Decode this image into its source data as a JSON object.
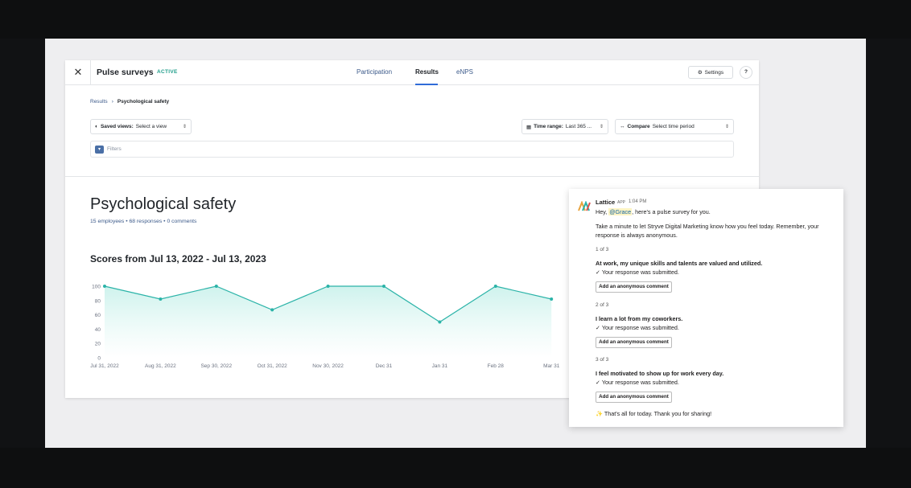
{
  "app": {
    "title": "Pulse surveys",
    "status_badge": "ACTIVE",
    "tabs": [
      {
        "label": "Participation"
      },
      {
        "label": "Results"
      },
      {
        "label": "eNPS"
      }
    ],
    "settings_label": "Settings",
    "help_label": "?",
    "close_icon": "close-icon"
  },
  "breadcrumb": {
    "root": "Results",
    "separator": "›",
    "current": "Psychological safety"
  },
  "controls": {
    "saved_views_label": "Saved views:",
    "saved_views_value": "Select a view",
    "time_range_label": "Time range:",
    "time_range_value": "Last 365 ...",
    "compare_label": "Compare",
    "compare_value": "Select time period",
    "filters_label": "Filters"
  },
  "report": {
    "title": "Psychological safety",
    "meta": "15 employees • 68 responses • 0 comments",
    "scores_title": "Scores from Jul 13, 2022 - Jul 13, 2023"
  },
  "chart_data": {
    "type": "area",
    "categories": [
      "Jul 31, 2022",
      "Aug 31, 2022",
      "Sep 30, 2022",
      "Oct 31, 2022",
      "Nov 30, 2022",
      "Dec 31",
      "Jan 31",
      "Feb 28",
      "Mar 31"
    ],
    "values": [
      100,
      82,
      100,
      67,
      100,
      100,
      50,
      100,
      82
    ],
    "yticks": [
      100,
      80,
      60,
      40,
      20,
      0
    ],
    "ylim": [
      0,
      100
    ],
    "colors": {
      "line": "#2bb3a8",
      "fill": "#d8f5f1"
    }
  },
  "slack": {
    "sender": "Lattice",
    "app_tag": "APP",
    "time": "1:04 PM",
    "greeting_pre": "Hey, ",
    "mention": "@Grace",
    "greeting_post": ", here's a pulse survey for you.",
    "intro": "Take a minute to let Stryve Digital Marketing know how you feel today. Remember, your response is always anonymous.",
    "questions": [
      {
        "step": "1 of 3",
        "text": "At work, my unique skills and talents are valued and utilized.",
        "status": "✓ Your response was submitted.",
        "button": "Add an anonymous comment"
      },
      {
        "step": "2 of 3",
        "text": "I learn a lot from my coworkers.",
        "status": "✓ Your response was submitted.",
        "button": "Add an anonymous comment"
      },
      {
        "step": "3 of 3",
        "text": "I feel motivated to show up for work every day.",
        "status": "✓ Your response was submitted.",
        "button": "Add an anonymous comment"
      }
    ],
    "closing": "✨ That's all for today. Thank you for sharing!"
  }
}
